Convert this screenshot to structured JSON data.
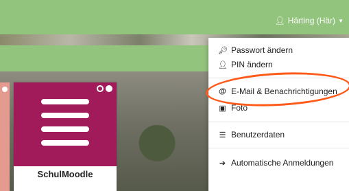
{
  "user": {
    "name": "Härting (Här)"
  },
  "tile": {
    "title": "SchulMoodle"
  },
  "menu": {
    "items": [
      {
        "label": "Passwort ändern",
        "icon": "key-icon"
      },
      {
        "label": "PIN ändern",
        "icon": "user-lock-icon"
      },
      {
        "label": "E-Mail & Benachrichtigungen",
        "icon": "at-icon"
      },
      {
        "label": "Foto",
        "icon": "image-icon"
      },
      {
        "label": "Benutzerdaten",
        "icon": "list-icon"
      },
      {
        "label": "Automatische Anmeldungen",
        "icon": "sign-in-icon"
      }
    ]
  },
  "colors": {
    "header": "#93c47d",
    "tile": "#a11a5a",
    "annotation": "#ff5a1a"
  }
}
